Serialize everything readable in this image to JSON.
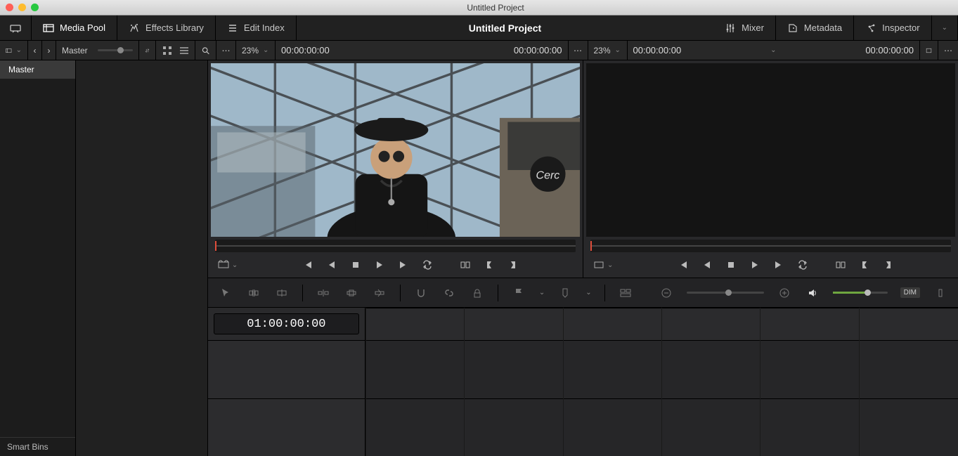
{
  "window": {
    "title": "Untitled Project"
  },
  "toolbar": {
    "media_pool": "Media Pool",
    "effects_library": "Effects Library",
    "edit_index": "Edit Index",
    "project_title": "Untitled Project",
    "mixer": "Mixer",
    "metadata": "Metadata",
    "inspector": "Inspector"
  },
  "secondbar": {
    "bin_label": "Master",
    "source_zoom_pct": "23%",
    "source_clip_tc": "00:00:00:00",
    "source_pos_tc": "00:00:00:00",
    "program_zoom_pct": "23%",
    "program_seq_tc": "00:00:00:00",
    "program_pos_tc": "00:00:00:00"
  },
  "sidebar": {
    "items": [
      "Master"
    ],
    "footer": "Smart Bins"
  },
  "timeline": {
    "timecode": "01:00:00:00"
  },
  "toolstrip": {
    "dim_label": "DIM"
  }
}
